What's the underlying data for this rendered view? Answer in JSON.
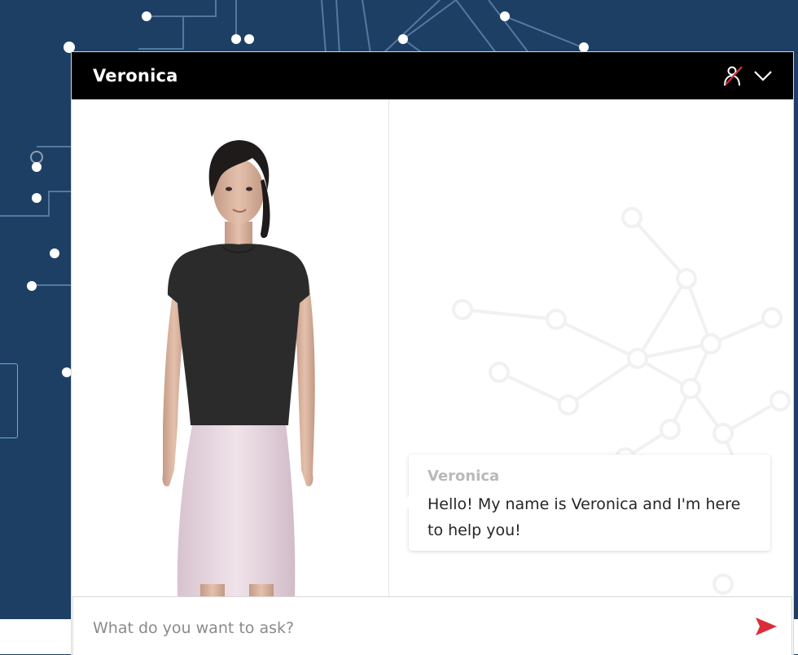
{
  "header": {
    "title": "Veronica",
    "icons": [
      "person-mute-icon",
      "chevron-down-icon"
    ]
  },
  "chat": {
    "messages": [
      {
        "sender": "Veronica",
        "text": "Hello! My name is Veronica and I'm here to help you!"
      }
    ]
  },
  "input": {
    "placeholder": "What do you want to ask?",
    "value": "",
    "send_icon": "send-arrow-icon"
  },
  "colors": {
    "background": "#1d3f64",
    "header": "#000000",
    "accent": "#d92e3a",
    "sender_name": "#b9b9b9"
  }
}
